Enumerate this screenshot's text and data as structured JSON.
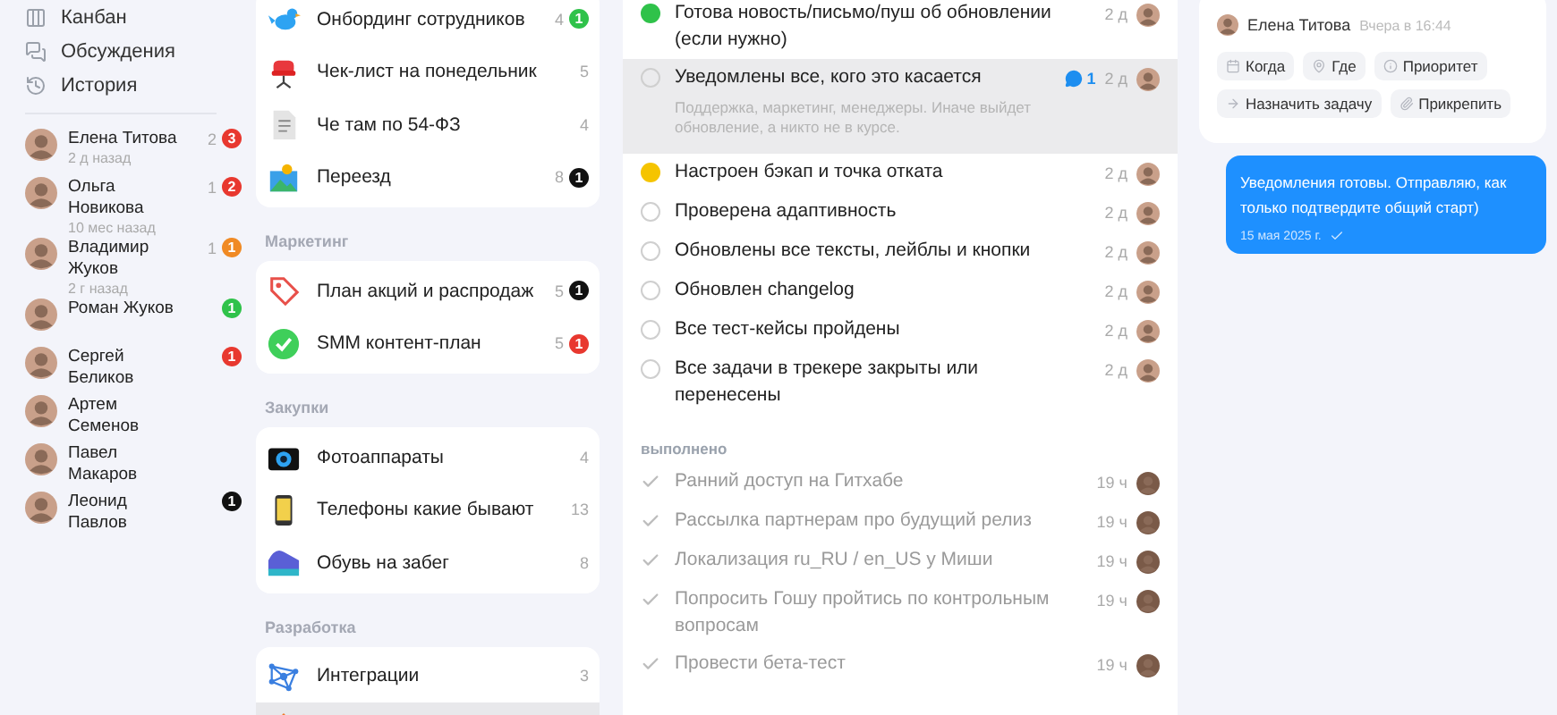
{
  "nav": [
    {
      "label": "Канбан"
    },
    {
      "label": "Обсуждения"
    },
    {
      "label": "История"
    }
  ],
  "people": [
    {
      "name": "Елена Титова",
      "time": "2 д назад",
      "count": "2",
      "badge": "3",
      "color": "#e8382f"
    },
    {
      "name": "Ольга Новикова",
      "time": "10 мес назад",
      "count": "1",
      "badge": "2",
      "color": "#e8382f"
    },
    {
      "name": "Владимир Жуков",
      "time": "2 г назад",
      "count": "1",
      "badge": "1",
      "color": "#f08a24"
    },
    {
      "name": "Роман Жуков",
      "badge": "1",
      "color": "#2fc24a"
    },
    {
      "name": "Сергей Беликов",
      "badge": "1",
      "color": "#e8382f"
    },
    {
      "name": "Артем Семенов"
    },
    {
      "name": "Павел Макаров"
    },
    {
      "name": "Леонид Павлов",
      "badge": "1",
      "color": "#111111"
    }
  ],
  "lists": [
    {
      "items": [
        {
          "name": "Онбординг сотрудников",
          "count": "4",
          "badge": "1",
          "color": "#2fc24a",
          "selected": false
        },
        {
          "name": "Чек-лист на понедельник",
          "count": "5",
          "selected": false
        },
        {
          "name": "Че там по 54-ФЗ",
          "count": "4",
          "selected": false
        },
        {
          "name": "Переезд",
          "count": "8",
          "badge": "1",
          "color": "#111111",
          "selected": false
        }
      ]
    },
    {
      "title": "Маркетинг",
      "items": [
        {
          "name": "План акций и распродаж",
          "count": "5",
          "badge": "1",
          "color": "#111111",
          "selected": false
        },
        {
          "name": "SMM контент-план",
          "count": "5",
          "badge": "1",
          "color": "#e8382f",
          "selected": false
        }
      ]
    },
    {
      "title": "Закупки",
      "items": [
        {
          "name": "Фотоаппараты",
          "count": "4",
          "selected": false
        },
        {
          "name": "Телефоны какие бывают",
          "count": "13",
          "selected": false
        },
        {
          "name": "Обувь на забег",
          "count": "8",
          "selected": false
        }
      ]
    },
    {
      "title": "Разработка",
      "items": [
        {
          "name": "Интеграции",
          "count": "3",
          "selected": false
        },
        {
          "selected": true
        }
      ]
    }
  ],
  "tasks": {
    "open": [
      {
        "kind": "dot",
        "color": "#2fc24a",
        "title": "Готова новость/письмо/пуш об обновлении (если нужно)",
        "age": "2 д",
        "selected": false
      },
      {
        "kind": "circle",
        "title": "Уведомлены все, кого это касается",
        "note": "Поддержка, маркетинг, менеджеры. Иначе выйдет обновление, а никто не в курсе.",
        "comments": "1",
        "age": "2 д",
        "selected": true
      },
      {
        "kind": "dot",
        "color": "#f5c400",
        "title": "Настроен бэкап и точка отката",
        "age": "2 д",
        "selected": false
      },
      {
        "kind": "circle",
        "title": "Проверена адаптивность",
        "age": "2 д",
        "selected": false
      },
      {
        "kind": "circle",
        "title": "Обновлены все тексты, лейблы и кнопки",
        "age": "2 д",
        "selected": false
      },
      {
        "kind": "circle",
        "title": "Обновлен changelog",
        "age": "2 д",
        "selected": false
      },
      {
        "kind": "circle",
        "title": "Все тест-кейсы пройдены",
        "age": "2 д",
        "selected": false
      },
      {
        "kind": "circle",
        "title": "Все задачи в трекере закрыты или перенесены",
        "age": "2 д",
        "selected": false
      }
    ],
    "done_heading": "выполнено",
    "done": [
      {
        "title": "Ранний доступ на Гитхабе",
        "age": "19 ч"
      },
      {
        "title": "Рассылка партнерам про будущий релиз",
        "age": "19 ч"
      },
      {
        "title": "Локализация ru_RU / en_US у Миши",
        "age": "19 ч"
      },
      {
        "title": "Попросить Гошу пройтись по контрольным вопросам",
        "age": "19 ч"
      },
      {
        "title": "Провести бета-тест",
        "age": "19 ч"
      }
    ]
  },
  "chat": {
    "author": "Елена Титова",
    "time": "Вчера в 16:44",
    "actions": [
      [
        {
          "label": "Когда"
        },
        {
          "label": "Где"
        },
        {
          "label": "Приоритет"
        }
      ],
      [
        {
          "label": "Назначить задачу"
        },
        {
          "label": "Прикрепить"
        }
      ]
    ],
    "message": {
      "text": "Уведомления готовы. Отправляю, как только подтвердите общий старт)",
      "date": "15 мая 2025 г."
    }
  }
}
